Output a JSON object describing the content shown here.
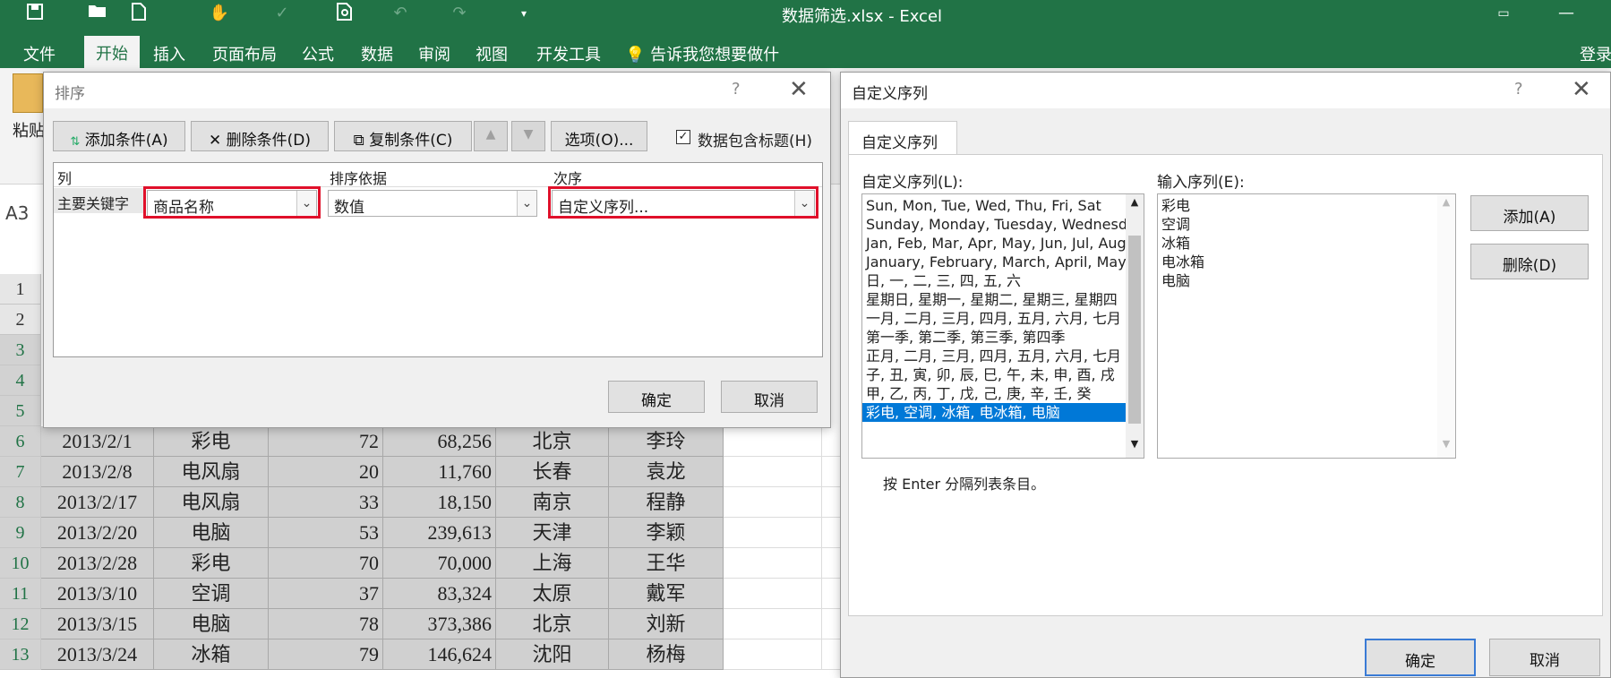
{
  "window": {
    "title": "数据筛选.xlsx - Excel"
  },
  "quick_access": [
    "save-icon",
    "open-folder-icon",
    "new-file-icon",
    "touch-mode-icon",
    "spelling-icon",
    "print-preview-icon",
    "undo-icon",
    "redo-icon",
    "customize-icon"
  ],
  "ribbon": {
    "tabs": [
      "文件",
      "开始",
      "插入",
      "页面布局",
      "公式",
      "数据",
      "审阅",
      "视图",
      "开发工具"
    ],
    "tell_me": "告诉我您想要做什么...",
    "login": "登录",
    "clipboard_paste": "粘贴"
  },
  "namebox": "A3",
  "rows": [
    "1",
    "2",
    "3",
    "4",
    "5",
    "6",
    "7",
    "8",
    "9",
    "10",
    "11",
    "12",
    "13"
  ],
  "table_rows": [
    [
      "2013/2/1",
      "彩电",
      "72",
      "68,256",
      "北京",
      "李玲"
    ],
    [
      "2013/2/8",
      "电风扇",
      "20",
      "11,760",
      "长春",
      "袁龙"
    ],
    [
      "2013/2/17",
      "电风扇",
      "33",
      "18,150",
      "南京",
      "程静"
    ],
    [
      "2013/2/20",
      "电脑",
      "53",
      "239,613",
      "天津",
      "李颖"
    ],
    [
      "2013/2/28",
      "彩电",
      "70",
      "70,000",
      "上海",
      "王华"
    ],
    [
      "2013/3/10",
      "空调",
      "37",
      "83,324",
      "太原",
      "戴军"
    ],
    [
      "2013/3/15",
      "电脑",
      "78",
      "373,386",
      "北京",
      "刘新"
    ],
    [
      "2013/3/24",
      "冰箱",
      "79",
      "146,624",
      "沈阳",
      "杨梅"
    ]
  ],
  "sort_dialog": {
    "title": "排序",
    "help": "?",
    "close": "✕",
    "add_condition": "添加条件(A)",
    "delete_condition": "删除条件(D)",
    "copy_condition": "复制条件(C)",
    "move_up": "▲",
    "move_down": "▼",
    "options": "选项(O)...",
    "has_headers": "数据包含标题(H)",
    "col_header": "列",
    "sort_on_header": "排序依据",
    "order_header": "次序",
    "primary_key": "主要关键字",
    "column_value": "商品名称",
    "sort_on_value": "数值",
    "order_value": "自定义序列...",
    "ok": "确定",
    "cancel": "取消"
  },
  "custom_lists_dialog": {
    "title": "自定义序列",
    "help": "?",
    "close": "✕",
    "tab": "自定义序列",
    "lists_label": "自定义序列(L):",
    "entries_label": "输入序列(E):",
    "lists": [
      "Sun, Mon, Tue, Wed, Thu, Fri, Sat",
      "Sunday, Monday, Tuesday, Wednesday",
      "Jan, Feb, Mar, Apr, May, Jun, Jul, Aug",
      "January, February, March, April, May",
      "日, 一, 二, 三, 四, 五, 六",
      "星期日, 星期一, 星期二, 星期三, 星期四",
      "一月, 二月, 三月, 四月, 五月, 六月, 七月",
      "第一季, 第二季, 第三季, 第四季",
      "正月, 二月, 三月, 四月, 五月, 六月, 七月",
      "子, 丑, 寅, 卯, 辰, 巳, 午, 未, 申, 酉, 戌",
      "甲, 乙, 丙, 丁, 戊, 己, 庚, 辛, 壬, 癸",
      "彩电, 空调, 冰箱, 电冰箱, 电脑"
    ],
    "entries": [
      "彩电",
      "空调",
      "冰箱",
      "电冰箱",
      "电脑"
    ],
    "add": "添加(A)",
    "delete": "删除(D)",
    "hint": "按 Enter 分隔列表条目。",
    "ok": "确定",
    "cancel": "取消"
  }
}
